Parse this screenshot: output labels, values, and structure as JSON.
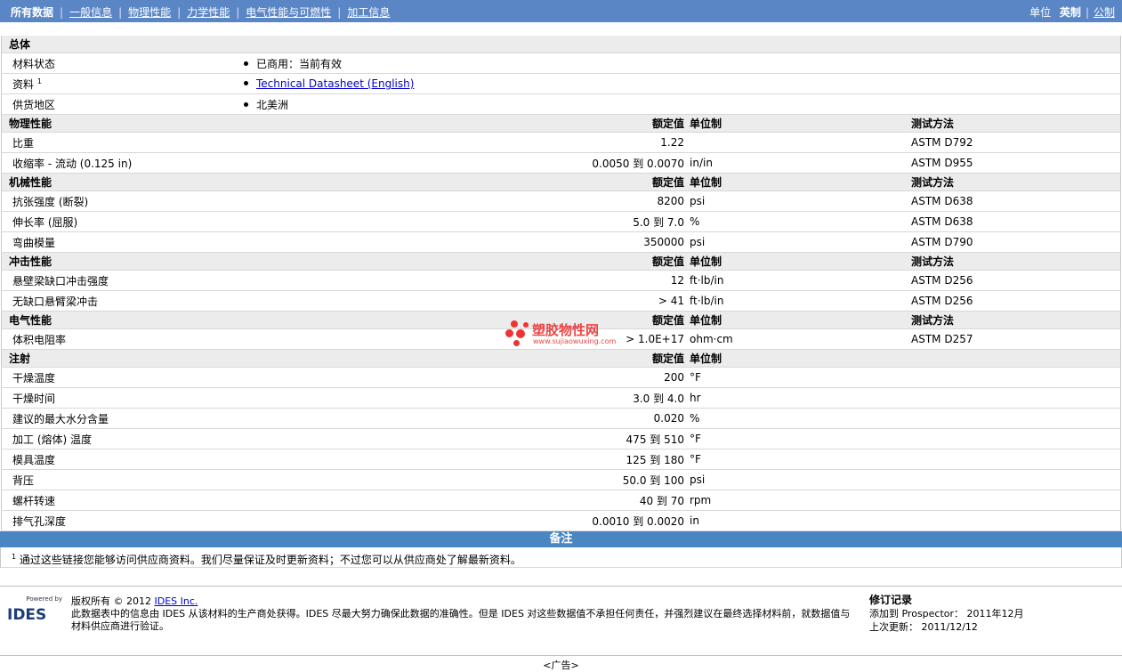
{
  "nav": {
    "tabs": [
      "所有数据",
      "一般信息",
      "物理性能",
      "力学性能",
      "电气性能与可燃性",
      "加工信息"
    ],
    "units_label": "单位",
    "units_imperial": "英制",
    "units_metric": "公制"
  },
  "general": {
    "title": "总体",
    "material_status_label": "材料状态",
    "material_status_value": "已商用：当前有效",
    "datasheet_label": "资料",
    "datasheet_sup": "1",
    "datasheet_link": "Technical Datasheet (English)",
    "region_label": "供货地区",
    "region_value": "北美洲"
  },
  "headers": {
    "nominal": "额定值",
    "unit": "单位制",
    "method": "测试方法"
  },
  "physical": {
    "title": "物理性能",
    "rows": [
      {
        "name": "比重",
        "value": "1.22",
        "unit": "",
        "method": "ASTM D792"
      },
      {
        "name": "收缩率 - 流动 (0.125 in)",
        "value": "0.0050 到  0.0070",
        "unit": "in/in",
        "method": "ASTM D955"
      }
    ]
  },
  "mechanical": {
    "title": "机械性能",
    "rows": [
      {
        "name": "抗张强度 (断裂)",
        "value": "8200",
        "unit": "psi",
        "method": "ASTM D638"
      },
      {
        "name": "伸长率 (屈服)",
        "value": "5.0 到  7.0",
        "unit": "%",
        "method": "ASTM D638"
      },
      {
        "name": "弯曲模量",
        "value": "350000",
        "unit": "psi",
        "method": "ASTM D790"
      }
    ]
  },
  "impact": {
    "title": "冲击性能",
    "rows": [
      {
        "name": "悬壁梁缺口冲击强度",
        "value": "12",
        "unit": "ft·lb/in",
        "method": "ASTM D256"
      },
      {
        "name": "无缺口悬臂梁冲击",
        "value": "> 41",
        "unit": "ft·lb/in",
        "method": "ASTM D256"
      }
    ]
  },
  "electrical": {
    "title": "电气性能",
    "rows": [
      {
        "name": "体积电阻率",
        "value": "> 1.0E+17",
        "unit": "ohm·cm",
        "method": "ASTM D257"
      }
    ]
  },
  "injection": {
    "title": "注射",
    "rows": [
      {
        "name": "干燥温度",
        "value": "200",
        "unit": "°F"
      },
      {
        "name": "干燥时间",
        "value": "3.0 到  4.0",
        "unit": "hr"
      },
      {
        "name": "建议的最大水分含量",
        "value": "0.020",
        "unit": "%"
      },
      {
        "name": "加工 (熔体) 温度",
        "value": "475 到  510",
        "unit": "°F"
      },
      {
        "name": "模具温度",
        "value": "125 到  180",
        "unit": "°F"
      },
      {
        "name": "背压",
        "value": "50.0 到  100",
        "unit": "psi"
      },
      {
        "name": "螺杆转速",
        "value": "40 到  70",
        "unit": "rpm"
      },
      {
        "name": "排气孔深度",
        "value": "0.0010 到  0.0020",
        "unit": "in"
      }
    ]
  },
  "notes": {
    "title": "备注",
    "sup": "1",
    "text": "通过这些链接您能够访问供应商资料。我们尽量保证及时更新资料；不过您可以从供应商处了解最新资料。"
  },
  "footer": {
    "powered_by": "Powered by",
    "logo_text": "IDES",
    "copyright_prefix": "版权所有 © 2012 ",
    "copyright_link": "IDES Inc.",
    "disclaimer": "此数据表中的信息由 IDES 从该材料的生产商处获得。IDES 尽最大努力确保此数据的准确性。但是 IDES 对这些数据值不承担任何责任，并强烈建议在最终选择材料前，就数据值与材料供应商进行验证。",
    "revision_title": "修订记录",
    "added_label": "添加到 Prospector：",
    "added_value": "2011年12月",
    "updated_label": "上次更新：",
    "updated_value": "2011/12/12",
    "ad": "<广告>"
  },
  "watermark": {
    "title": "塑胶物性网",
    "url": "www.sujiaowuxing.com"
  }
}
